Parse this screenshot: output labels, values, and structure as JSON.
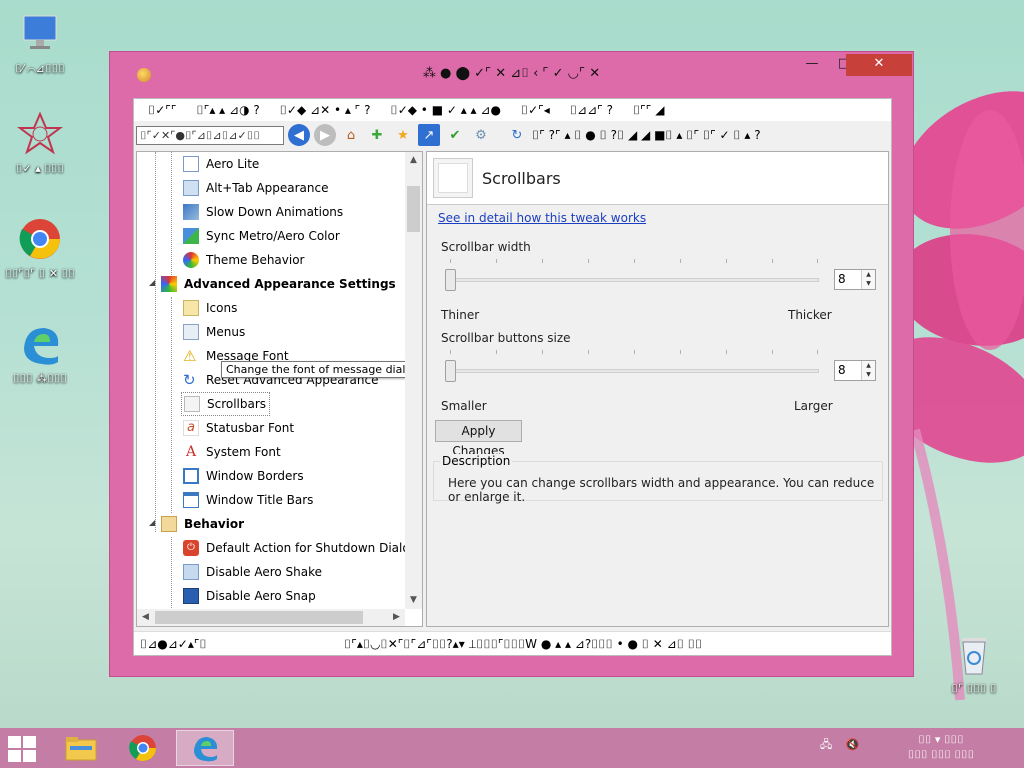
{
  "desktop": {
    "icons": [
      {
        "label": "⌷⁄ ⌒⊿⌷⌷⌷",
        "icon": "computer-icon"
      },
      {
        "label": "⌷✓ ▴ ⌷⌷⌷",
        "icon": "app-icon"
      },
      {
        "label": "⌷⌷⌜⌷⌜ ⌷ ✕ ⌷⌷",
        "icon": "chrome-icon"
      },
      {
        "label": "⌷⌷⌷ ⁂⌷⌷⌷",
        "icon": "edge-icon"
      },
      {
        "label": "⌷⌜ ⌷⌷⌷ ⌷",
        "icon": "recycle-bin-icon"
      }
    ]
  },
  "window": {
    "title": "⁂ ● ⬤ ✓⌜ ✕ ⊿⌷ ‹ ⌜ ✓ ◡⌜ ✕",
    "controls": {
      "minimize": "—",
      "maximize": "□",
      "close": "✕"
    }
  },
  "menu": [
    "⌷✓⌜⌜",
    "⌷⌜▴ ▴ ⊿◑ ?",
    "⌷✓◆ ⊿✕ • ▴ ⌜ ?",
    "⌷✓◆ • ■ ✓ ▴ ▴ ⊿●",
    "⌷✓⌜◂",
    "⌷⊿⊿⌜ ?",
    "⌷⌜⌜ ◢"
  ],
  "toolbar": {
    "search_value": "⌷⌜✓✕⌜●⌷⌜⊿⌷⊿⌷⊿✓⌷⌷",
    "label": "⌷⌜ ?⌜ ▴ ⌷ ● ⌷ ?⌷ ◢ ◢ ■⌷ ▴ ⌷⌜ ⌷⌜ ✓ ⌷ ▴ ?"
  },
  "tree": {
    "items": [
      {
        "label": "Aero Lite",
        "icon": "window-icon"
      },
      {
        "label": "Alt+Tab Appearance",
        "icon": "alttab-icon"
      },
      {
        "label": "Slow Down Animations",
        "icon": "animation-icon"
      },
      {
        "label": "Sync Metro/Aero Color",
        "icon": "color-sync-icon"
      },
      {
        "label": "Theme Behavior",
        "icon": "theme-icon"
      },
      {
        "label": "Advanced Appearance Settings",
        "icon": "palette-icon",
        "category": true
      },
      {
        "label": "Icons",
        "icon": "icons-icon"
      },
      {
        "label": "Menus",
        "icon": "menus-icon"
      },
      {
        "label": "Message Font",
        "icon": "warning-icon"
      },
      {
        "label": "Reset Advanced Appearance",
        "icon": "reset-icon"
      },
      {
        "label": "Scrollbars",
        "icon": "scrollbar-icon"
      },
      {
        "label": "Statusbar Font",
        "icon": "statusbar-font-icon"
      },
      {
        "label": "System Font",
        "icon": "system-font-icon"
      },
      {
        "label": "Window Borders",
        "icon": "window-borders-icon"
      },
      {
        "label": "Window Title Bars",
        "icon": "title-bars-icon"
      },
      {
        "label": "Behavior",
        "icon": "behavior-icon",
        "category": true
      },
      {
        "label": "Default Action for Shutdown Dialog",
        "icon": "shutdown-icon"
      },
      {
        "label": "Disable Aero Shake",
        "icon": "aero-shake-icon"
      },
      {
        "label": "Disable Aero Snap",
        "icon": "aero-snap-icon"
      }
    ],
    "tooltip": "Change the font of message dialog."
  },
  "content": {
    "title": "Scrollbars",
    "detail_link": "See in detail how this tweak works",
    "scrollbar_width_label": "Scrollbar width",
    "scrollbar_width_value": "8",
    "thinner": "Thiner",
    "thicker": "Thicker",
    "buttons_size_label": "Scrollbar buttons size",
    "buttons_size_value": "8",
    "smaller": "Smaller",
    "larger": "Larger",
    "apply": "Apply Changes",
    "description_title": "Description",
    "description_text": "Here you can change scrollbars width and appearance. You can reduce or enlarge it."
  },
  "statusbar": {
    "left": "⌷⊿●⊿✓▴⌜⌷",
    "right": "⌷⌜▴⌷◡⌷✕⌜⌷⌜⊿⌜⌷⌷?▴▾ ⟂⌷⌷⌷⌜⌷⌷⌷W ● ▴ ▴ ⊿?⌷⌷⌷ • ● ⌷ ✕ ⊿⌷ ⌷⌷"
  },
  "taskbar": {
    "apps": [
      "file-explorer-icon",
      "chrome-icon",
      "edge-icon"
    ],
    "tray": "⌷ ⌷",
    "clock_line1": "⌷⌷ ▾ ⌷⌷⌷",
    "clock_line2": "⌷⌷⌷ ⌷⌷⌷ ⌷⌷⌷"
  },
  "colors": {
    "window_frame": "#dd6aa9",
    "close_button": "#c7413a",
    "link": "#1a3fc0",
    "taskbar": "#c47ea5"
  }
}
